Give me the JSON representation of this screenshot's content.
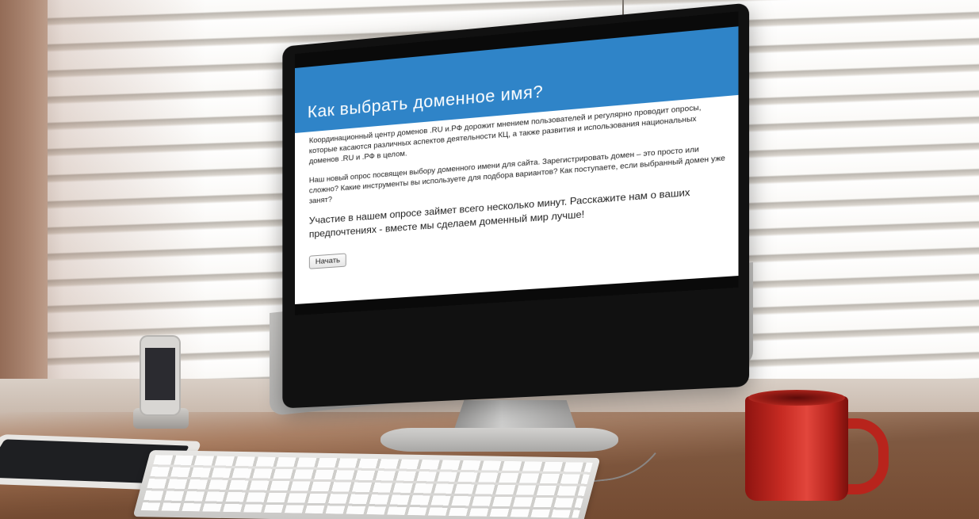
{
  "screen": {
    "title": "Как выбрать доменное имя?",
    "paragraph1": "Координационный центр доменов .RU и.РФ дорожит мнением пользователей и регулярно проводит опросы, которые касаются различных аспектов деятельности КЦ, а также развития и использования национальных доменов .RU и .РФ в целом.",
    "paragraph2": "Наш новый опрос посвящен выбору доменного имени для сайта. Зарегистрировать домен – это просто или сложно? Какие инструменты вы используете для подбора вариантов? Как поступаете, если выбранный домен уже занят?",
    "paragraph3": "Участие в нашем опросе займет всего несколько минут. Расскажите нам о ваших предпочтениях - вместе мы сделаем доменный мир лучше!",
    "start_button": "Начать",
    "header_color": "#2f84c8"
  },
  "icons": {
    "brand_logo": "apple-logo-icon"
  },
  "colors": {
    "mug": "#c62a22",
    "desk": "#b68f76"
  }
}
